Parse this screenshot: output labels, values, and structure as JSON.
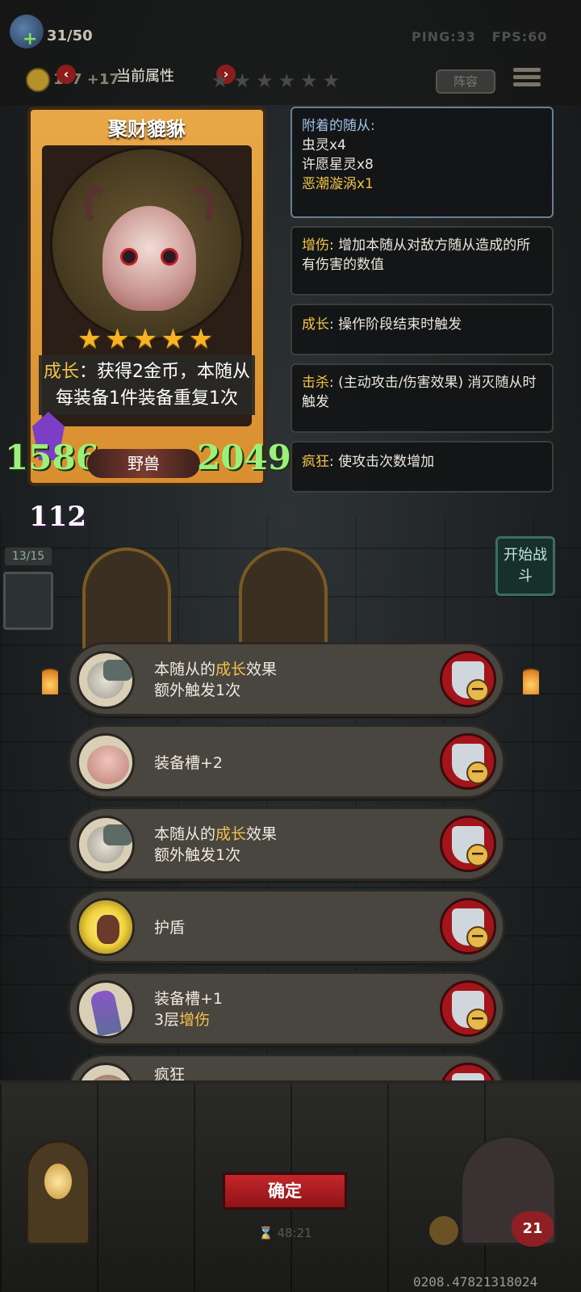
{
  "topbar": {
    "population": "31/50",
    "ping": "PING:33",
    "fps": "FPS:60",
    "gold": "1?7 +17",
    "lineup_label": "阵容"
  },
  "attr_header": {
    "title": "当前属性",
    "prev_icon": "chevron-left-icon",
    "next_icon": "chevron-right-icon",
    "stars_shown": 6
  },
  "card": {
    "name": "聚财貔貅",
    "star_count": 5,
    "desc_keyword": "成长",
    "desc_rest": "：获得2金币，本随从每装备1件装备重复1次",
    "attack": "1586",
    "health": "2049",
    "tribe": "野兽",
    "extra_stat": "112"
  },
  "attached": {
    "title": "附着的随从:",
    "items": [
      {
        "text": "虫灵x4",
        "color": "#ece7db"
      },
      {
        "text": "许愿星灵x8",
        "color": "#ece7db"
      },
      {
        "text": "恶潮漩涡x1",
        "color": "#f3c34a"
      }
    ]
  },
  "keywords": [
    {
      "label": "增伤",
      "text": ": 增加本随从对敌方随从造成的所有伤害的数值"
    },
    {
      "label": "成长",
      "text": ": 操作阶段结束时触发"
    },
    {
      "label": "击杀",
      "text": ": (主动攻击/伤害效果) 消灭随从时触发"
    },
    {
      "label": "疯狂",
      "text": ": 使攻击次数增加"
    }
  ],
  "board": {
    "slot_count": "13/15",
    "start_button": "开始战斗"
  },
  "equipment": [
    {
      "icon": "gauntlet-clock-icon",
      "line1_pre": "本随从的",
      "line1_kw": "成长",
      "line1_post": "效果",
      "line2": "额外触发1次"
    },
    {
      "icon": "pig-icon",
      "single": "装备槽+2"
    },
    {
      "icon": "gauntlet-clock-icon",
      "line1_pre": "本随从的",
      "line1_kw": "成长",
      "line1_post": "效果",
      "line2": "额外触发1次"
    },
    {
      "icon": "golden-shield-icon",
      "single_kw": "护盾"
    },
    {
      "icon": "purple-glove-icon",
      "line1_pre": "装备槽+1",
      "line2_pre": "3层",
      "line2_kw": "增伤"
    },
    {
      "icon": "rage-icon",
      "single_kw": "疯狂"
    }
  ],
  "bottom": {
    "confirm": "确定",
    "timer": "48:21",
    "lives": "21",
    "build_id": "0208.47821318024"
  },
  "colors": {
    "keyword": "#f3c34a",
    "stat_green": "#9bf07b",
    "confirm_red": "#c5262a"
  }
}
